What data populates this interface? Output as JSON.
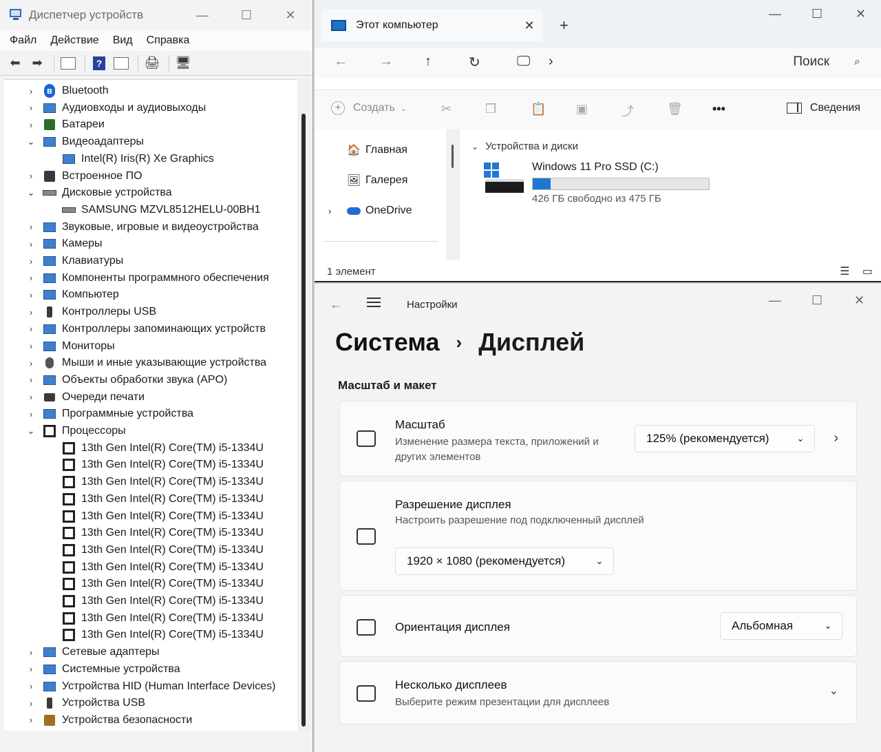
{
  "device_manager": {
    "title": "Диспетчер устройств",
    "menu": [
      "Файл",
      "Действие",
      "Вид",
      "Справка"
    ],
    "tree": [
      {
        "label": "Bluetooth",
        "level": 0,
        "expanded": false,
        "icon": "bluetooth-icon"
      },
      {
        "label": "Аудиовходы и аудиовыходы",
        "level": 0,
        "expanded": false,
        "icon": "speaker-icon"
      },
      {
        "label": "Батареи",
        "level": 0,
        "expanded": false,
        "icon": "battery-icon"
      },
      {
        "label": "Видеоадаптеры",
        "level": 0,
        "expanded": true,
        "icon": "display-adapter-icon"
      },
      {
        "label": "Intel(R) Iris(R) Xe Graphics",
        "level": 1,
        "icon": "display-adapter-icon"
      },
      {
        "label": "Встроенное ПО",
        "level": 0,
        "expanded": false,
        "icon": "firmware-icon"
      },
      {
        "label": "Дисковые устройства",
        "level": 0,
        "expanded": true,
        "icon": "disk-icon"
      },
      {
        "label": "SAMSUNG MZVL8512HELU-00BH1",
        "level": 1,
        "icon": "disk-icon"
      },
      {
        "label": "Звуковые, игровые и видеоустройства",
        "level": 0,
        "expanded": false,
        "icon": "speaker-icon"
      },
      {
        "label": "Камеры",
        "level": 0,
        "expanded": false,
        "icon": "camera-icon"
      },
      {
        "label": "Клавиатуры",
        "level": 0,
        "expanded": false,
        "icon": "keyboard-icon"
      },
      {
        "label": "Компоненты программного обеспечения",
        "level": 0,
        "expanded": false,
        "icon": "software-component-icon"
      },
      {
        "label": "Компьютер",
        "level": 0,
        "expanded": false,
        "icon": "computer-icon"
      },
      {
        "label": "Контроллеры USB",
        "level": 0,
        "expanded": false,
        "icon": "usb-icon"
      },
      {
        "label": "Контроллеры запоминающих устройств",
        "level": 0,
        "expanded": false,
        "icon": "storage-controller-icon"
      },
      {
        "label": "Мониторы",
        "level": 0,
        "expanded": false,
        "icon": "monitor-icon"
      },
      {
        "label": "Мыши и иные указывающие устройства",
        "level": 0,
        "expanded": false,
        "icon": "mouse-icon"
      },
      {
        "label": "Объекты обработки звука (APO)",
        "level": 0,
        "expanded": false,
        "icon": "speaker-icon"
      },
      {
        "label": "Очереди печати",
        "level": 0,
        "expanded": false,
        "icon": "printer-icon"
      },
      {
        "label": "Программные устройства",
        "level": 0,
        "expanded": false,
        "icon": "software-device-icon"
      },
      {
        "label": "Процессоры",
        "level": 0,
        "expanded": true,
        "icon": "cpu-icon"
      },
      {
        "label": "13th Gen Intel(R) Core(TM) i5-1334U",
        "level": 1,
        "icon": "cpu-icon"
      },
      {
        "label": "13th Gen Intel(R) Core(TM) i5-1334U",
        "level": 1,
        "icon": "cpu-icon"
      },
      {
        "label": "13th Gen Intel(R) Core(TM) i5-1334U",
        "level": 1,
        "icon": "cpu-icon"
      },
      {
        "label": "13th Gen Intel(R) Core(TM) i5-1334U",
        "level": 1,
        "icon": "cpu-icon"
      },
      {
        "label": "13th Gen Intel(R) Core(TM) i5-1334U",
        "level": 1,
        "icon": "cpu-icon"
      },
      {
        "label": "13th Gen Intel(R) Core(TM) i5-1334U",
        "level": 1,
        "icon": "cpu-icon"
      },
      {
        "label": "13th Gen Intel(R) Core(TM) i5-1334U",
        "level": 1,
        "icon": "cpu-icon"
      },
      {
        "label": "13th Gen Intel(R) Core(TM) i5-1334U",
        "level": 1,
        "icon": "cpu-icon"
      },
      {
        "label": "13th Gen Intel(R) Core(TM) i5-1334U",
        "level": 1,
        "icon": "cpu-icon"
      },
      {
        "label": "13th Gen Intel(R) Core(TM) i5-1334U",
        "level": 1,
        "icon": "cpu-icon"
      },
      {
        "label": "13th Gen Intel(R) Core(TM) i5-1334U",
        "level": 1,
        "icon": "cpu-icon"
      },
      {
        "label": "13th Gen Intel(R) Core(TM) i5-1334U",
        "level": 1,
        "icon": "cpu-icon"
      },
      {
        "label": "Сетевые адаптеры",
        "level": 0,
        "expanded": false,
        "icon": "network-adapter-icon"
      },
      {
        "label": "Системные устройства",
        "level": 0,
        "expanded": false,
        "icon": "system-device-icon"
      },
      {
        "label": "Устройства HID (Human Interface Devices)",
        "level": 0,
        "expanded": false,
        "icon": "hid-icon"
      },
      {
        "label": "Устройства USB",
        "level": 0,
        "expanded": false,
        "icon": "usb-icon"
      },
      {
        "label": "Устройства безопасности",
        "level": 0,
        "expanded": false,
        "icon": "security-device-icon"
      }
    ]
  },
  "explorer": {
    "tab_title": "Этот компьютер",
    "search_label": "Поиск",
    "create_label": "Создать",
    "details_label": "Сведения",
    "nav": [
      {
        "label": "Главная",
        "icon": "home-icon"
      },
      {
        "label": "Галерея",
        "icon": "gallery-icon"
      },
      {
        "label": "OneDrive",
        "icon": "onedrive-icon"
      }
    ],
    "group_header": "Устройства и диски",
    "drive": {
      "name": "Windows 11 Pro SSD (C:)",
      "free_text": "426 ГБ свободно из 475 ГБ",
      "used_fraction": 0.103
    },
    "status": "1 элемент"
  },
  "settings": {
    "app_title": "Настройки",
    "breadcrumb": [
      "Система",
      "Дисплей"
    ],
    "section": "Масштаб и макет",
    "cards": {
      "scale": {
        "title": "Масштаб",
        "subtitle": "Изменение размера текста, приложений и других элементов",
        "value": "125% (рекомендуется)"
      },
      "resolution": {
        "title": "Разрешение дисплея",
        "subtitle": "Настроить разрешение под подключенный дисплей",
        "value": "1920 × 1080 (рекомендуется)"
      },
      "orientation": {
        "title": "Ориентация дисплея",
        "value": "Альбомная"
      },
      "multi": {
        "title": "Несколько дисплеев",
        "subtitle": "Выберите режим презентации для дисплеев"
      }
    }
  }
}
